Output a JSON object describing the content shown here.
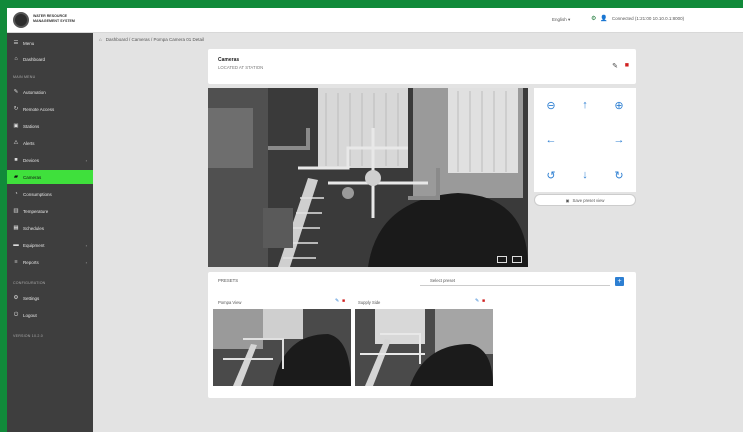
{
  "app": {
    "logo_text": "WATER RESOURCE MANAGEMENT SYSTEM"
  },
  "topbar": {
    "language": "English",
    "user": "Connected (1:21:00 10.10.0.1:8000)"
  },
  "sidebar": {
    "items": [
      {
        "label": "Menu",
        "icon": "hamburger-icon"
      },
      {
        "label": "Dashboard",
        "icon": "home-icon"
      },
      {
        "label": "Automation",
        "icon": "wrench-icon"
      },
      {
        "label": "Remote Access",
        "icon": "remote-icon"
      },
      {
        "label": "Stations",
        "icon": "station-icon"
      },
      {
        "label": "Alerts",
        "icon": "bell-icon"
      },
      {
        "label": "Devices",
        "icon": "device-icon"
      },
      {
        "label": "Cameras",
        "icon": "camera-icon"
      },
      {
        "label": "Consumptions",
        "icon": "gauge-icon"
      },
      {
        "label": "Temperature",
        "icon": "chart-icon"
      },
      {
        "label": "Schedules",
        "icon": "calendar-icon"
      },
      {
        "label": "Equipment",
        "icon": "equipment-icon"
      },
      {
        "label": "Reports",
        "icon": "report-icon"
      },
      {
        "label": "Settings",
        "icon": "gear-icon"
      },
      {
        "label": "Logout",
        "icon": "logout-icon"
      }
    ],
    "section_main": "MAIN MENU",
    "section_config": "CONFIGURATION",
    "section_footer": "VERSION 10.2.0"
  },
  "breadcrumb": "Dashboard / Cameras / Pompa Camera 01 Detail",
  "camera": {
    "title": "Cameras",
    "subtitle": "LOCATED AT STATION"
  },
  "ptz": {
    "preset_button_label": "Save preset view"
  },
  "presets": {
    "label": "PRESETS",
    "select_placeholder": "Select preset",
    "items": [
      {
        "label": "Pompa View"
      },
      {
        "label": "Supply Side"
      }
    ]
  },
  "colors": {
    "accent": "#3fe03c",
    "brand_frame": "#118a3a",
    "action_blue": "#2d7fd2",
    "danger": "#d02020"
  }
}
